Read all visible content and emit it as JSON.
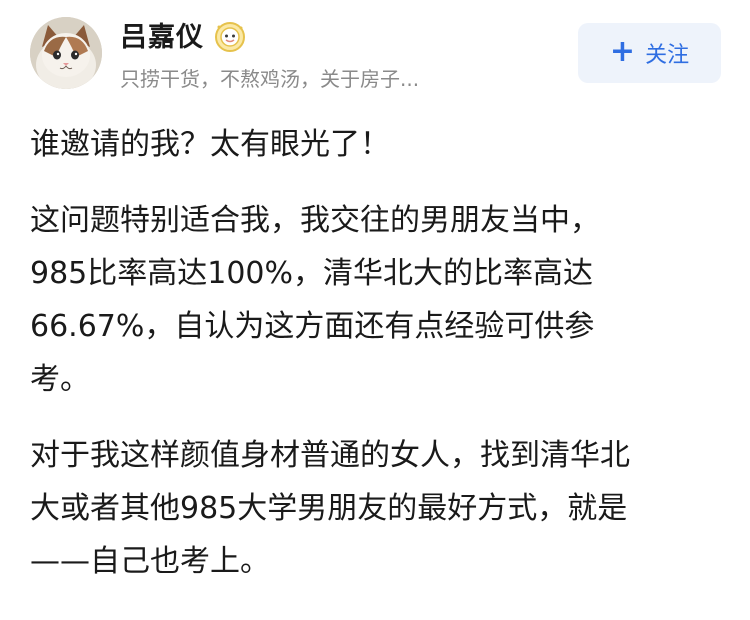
{
  "author": {
    "name": "吕嘉仪",
    "bio": "只捞干货，不熬鸡汤，关于房子...",
    "badge_icon": "sparkle-badge-icon",
    "avatar_icon": "cat-avatar"
  },
  "follow_button": {
    "label": "关注",
    "icon": "plus-icon",
    "icon_glyph": "+"
  },
  "post": {
    "paragraphs": [
      {
        "lines": [
          "谁邀请的我？太有眼光了！"
        ]
      },
      {
        "lines": [
          "这问题特别适合我，我交往的男朋友当中，",
          "985比率高达100%，清华北大的比率高达",
          "66.67%，自认为这方面还有点经验可供参",
          "考。"
        ]
      },
      {
        "lines": [
          "对于我这样颜值身材普通的女人，找到清华北",
          "大或者其他985大学男朋友的最好方式，就是",
          "——自己也考上。"
        ]
      }
    ]
  },
  "colors": {
    "accent": "#2f6ee2",
    "button_bg": "#eef3fb",
    "muted_text": "#8a8a8a",
    "body_text": "#1a1a1a"
  }
}
